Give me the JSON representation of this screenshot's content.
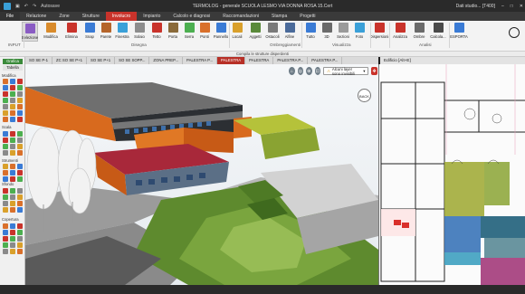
{
  "window": {
    "title": "TERMOLOG - generale SCUOLA LESMO VIA DONNA ROSA 15.Cert",
    "quick_access_label": "Autosave",
    "user_label": "Dati studio... [T400]"
  },
  "menu_tabs": [
    {
      "label": "File",
      "state": "file"
    },
    {
      "label": "Relazione",
      "state": "normal"
    },
    {
      "label": "Zone",
      "state": "normal"
    },
    {
      "label": "Strutture",
      "state": "normal"
    },
    {
      "label": "Involucro",
      "state": "active"
    },
    {
      "label": "Impianto",
      "state": "normal"
    },
    {
      "label": "Calcolo e diagnosi",
      "state": "normal"
    },
    {
      "label": "Raccomandazioni",
      "state": "normal"
    },
    {
      "label": "Stampa",
      "state": "normal"
    },
    {
      "label": "Progetti",
      "state": "normal"
    }
  ],
  "ribbon": {
    "groups": [
      {
        "label": "INPUT"
      },
      {
        "label": "Disegna"
      },
      {
        "label": "Ombreggiamenti"
      },
      {
        "label": "Visualizza"
      },
      {
        "label": "Analisi"
      }
    ],
    "buttons": [
      {
        "label": "Selezione",
        "icon": "cursor-icon",
        "color": "#8a5cc4",
        "selected": true
      },
      {
        "label": "Modifica",
        "icon": "pencil-icon",
        "color": "#d98b2b"
      },
      {
        "label": "Elimina",
        "icon": "delete-icon",
        "color": "#c9332b"
      },
      {
        "label": "Snap",
        "icon": "magnet-icon",
        "color": "#3a7bd5"
      },
      {
        "label": "Parete",
        "icon": "wall-icon",
        "color": "#b5652b"
      },
      {
        "label": "Finestra",
        "icon": "window-icon",
        "color": "#3aa0d8"
      },
      {
        "label": "Solaio",
        "icon": "slab-icon",
        "color": "#8d8d8d"
      },
      {
        "label": "Tetto",
        "icon": "roof-icon",
        "color": "#c9332b"
      },
      {
        "label": "Porta",
        "icon": "door-icon",
        "color": "#8a6a3a"
      },
      {
        "label": "Serra",
        "icon": "greenhouse-icon",
        "color": "#4caf50"
      },
      {
        "label": "Ponti",
        "icon": "bridge-icon",
        "color": "#d9702b"
      },
      {
        "label": "Pannello",
        "icon": "panel-icon",
        "color": "#3a7bd5"
      },
      {
        "label": "Locali",
        "icon": "rooms-icon",
        "color": "#d9a02b"
      },
      {
        "label": "Aggetti",
        "icon": "overhang-icon",
        "color": "#5a8a3a"
      },
      {
        "label": "Ostacoli",
        "icon": "obstacle-icon",
        "color": "#7a7a7a"
      },
      {
        "label": "Alfine",
        "icon": "side-fin-icon",
        "color": "#4a6a9a"
      },
      {
        "label": "Tutto",
        "icon": "show-all-icon",
        "color": "#3a7bd5"
      },
      {
        "label": "3D",
        "icon": "cube-3d-icon",
        "color": "#6a6a6a"
      },
      {
        "label": "Sezioni",
        "icon": "section-icon",
        "color": "#9a9a9a"
      },
      {
        "label": "Foto",
        "icon": "photo-icon",
        "color": "#3aa0d8"
      },
      {
        "label": "Dispersioni",
        "icon": "dispersion-icon",
        "color": "#c9332b"
      },
      {
        "label": "Analizza",
        "icon": "analyze-icon",
        "color": "#c9332b"
      },
      {
        "label": "Ombre",
        "icon": "shadow-icon",
        "color": "#6a6a6a"
      },
      {
        "label": "Calcola...",
        "icon": "calculator-icon",
        "color": "#4a4a4a"
      },
      {
        "label": "ESPORTA",
        "icon": "export-icon",
        "color": "#3a7bd5"
      }
    ],
    "help_icon": "help-icon"
  },
  "subbar_text": "Compila le strutture disperdenti",
  "left_panel": {
    "grafica_label": "Grafica",
    "tabella_label": "Tabella",
    "sections": [
      "Modifica",
      "Scala",
      "Strumenti",
      "Sfondo",
      "Copertura"
    ]
  },
  "document_tabs": [
    {
      "label": "SO SE P-1",
      "active": false
    },
    {
      "label": "ZC SO SE P+1",
      "active": false
    },
    {
      "label": "SO SE P+1",
      "active": false
    },
    {
      "label": "SO SE SOPP...",
      "active": false
    },
    {
      "label": "ZONA PREP...",
      "active": false
    },
    {
      "label": "PALESTRA P...",
      "active": false
    },
    {
      "label": "PALESTRA",
      "active": true
    },
    {
      "label": "PALESTRA",
      "active": false
    },
    {
      "label": "PALESTRA P...",
      "active": false
    },
    {
      "label": "PALESTRA P...",
      "active": false
    }
  ],
  "view3d": {
    "layer_select": "Alcuni layer sono invisibili",
    "back_label": "BACK"
  },
  "right_panel": {
    "tab_label": "Edificio [Alt+E]"
  },
  "colors": {
    "accent": "#c9332b",
    "titlebar": "#2a2a2a",
    "roof_red": "#a8283a",
    "orange_wall": "#d86a1e",
    "grass": "#6f9a3a"
  }
}
